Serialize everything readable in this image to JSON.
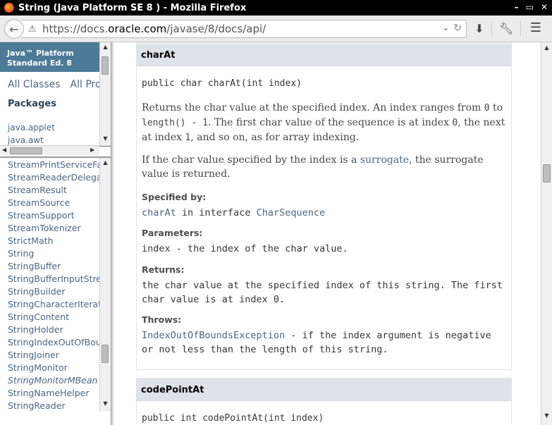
{
  "window": {
    "title": "String (Java Platform SE 8 ) - Mozilla Firefox",
    "controls": [
      "–",
      "▭",
      "✕"
    ]
  },
  "toolbar": {
    "url_prefix": "https://docs.",
    "url_domain": "oracle.com",
    "url_path": "/javase/8/docs/api/",
    "icons": [
      "back-icon",
      "info-icon",
      "dropdown-icon",
      "reload-icon",
      "download-icon",
      "wrench-icon",
      "menu-icon"
    ]
  },
  "left_top": {
    "brand_line1": "Java™ Platform",
    "brand_line2": "Standard Ed. 8",
    "all_classes": "All Classes",
    "all_profiles": "All Pro",
    "packages_heading": "Packages",
    "packages": [
      "java.applet",
      "java.awt"
    ]
  },
  "left_bottom": {
    "classes": [
      {
        "name": "StreamPrintServiceFa",
        "italic": false
      },
      {
        "name": "StreamReaderDelegat",
        "italic": false
      },
      {
        "name": "StreamResult",
        "italic": false
      },
      {
        "name": "StreamSource",
        "italic": false
      },
      {
        "name": "StreamSupport",
        "italic": false
      },
      {
        "name": "StreamTokenizer",
        "italic": false
      },
      {
        "name": "StrictMath",
        "italic": false
      },
      {
        "name": "String",
        "italic": false
      },
      {
        "name": "StringBuffer",
        "italic": false
      },
      {
        "name": "StringBufferInputStre",
        "italic": false
      },
      {
        "name": "StringBuilder",
        "italic": false
      },
      {
        "name": "StringCharacterIterat",
        "italic": false
      },
      {
        "name": "StringContent",
        "italic": false
      },
      {
        "name": "StringHolder",
        "italic": false
      },
      {
        "name": "StringIndexOutOfBou",
        "italic": false
      },
      {
        "name": "StringJoiner",
        "italic": false
      },
      {
        "name": "StringMonitor",
        "italic": false
      },
      {
        "name": "StringMonitorMBean",
        "italic": true
      },
      {
        "name": "StringNameHelper",
        "italic": false
      },
      {
        "name": "StringReader",
        "italic": false
      }
    ]
  },
  "method1": {
    "name": "charAt",
    "signature": "public char charAt(int index)",
    "desc1_a": "Returns the char value at the specified index. An index ranges from ",
    "desc1_code1": "0",
    "desc1_b": " to ",
    "desc1_code2": "length() - 1",
    "desc1_c": ". The first char value of the sequence is at index ",
    "desc1_code3": "0",
    "desc1_d": ", the next at index ",
    "desc1_code4": "1",
    "desc1_e": ", and so on, as for array indexing.",
    "desc2_a": "If the char value specified by the index is a ",
    "desc2_link": "surrogate",
    "desc2_b": ", the surrogate value is returned.",
    "specified_by_label": "Specified by:",
    "specified_by_method": "charAt",
    "specified_by_mid": " in interface ",
    "specified_by_iface": "CharSequence",
    "params_label": "Parameters:",
    "params_text": "index - the index of the char value.",
    "returns_label": "Returns:",
    "returns_text": "the char value at the specified index of this string. The first char value is at index 0.",
    "throws_label": "Throws:",
    "throws_link": "IndexOutOfBoundsException",
    "throws_text": " - if the index argument is negative or not less than the length of this string."
  },
  "method2": {
    "name": "codePointAt",
    "signature": "public int codePointAt(int index)"
  }
}
